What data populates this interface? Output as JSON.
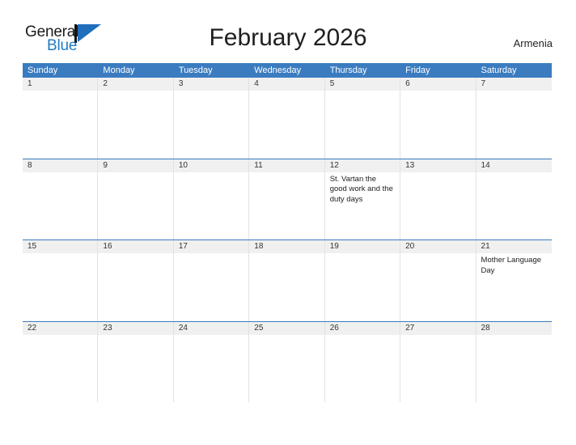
{
  "brand": {
    "name_part1": "General",
    "name_part2": "Blue",
    "logo_icon": "triangle-flag-icon",
    "accent_color": "#1f6fbb"
  },
  "header": {
    "title": "February 2026",
    "country": "Armenia"
  },
  "colors": {
    "header_blue": "#3b7cc0",
    "number_band": "#f0f0f0",
    "grid_line": "#e2e2e2",
    "text": "#222222"
  },
  "calendar": {
    "weekday_headers": [
      "Sunday",
      "Monday",
      "Tuesday",
      "Wednesday",
      "Thursday",
      "Friday",
      "Saturday"
    ],
    "weeks": [
      [
        {
          "day": "1",
          "events": []
        },
        {
          "day": "2",
          "events": []
        },
        {
          "day": "3",
          "events": []
        },
        {
          "day": "4",
          "events": []
        },
        {
          "day": "5",
          "events": []
        },
        {
          "day": "6",
          "events": []
        },
        {
          "day": "7",
          "events": []
        }
      ],
      [
        {
          "day": "8",
          "events": []
        },
        {
          "day": "9",
          "events": []
        },
        {
          "day": "10",
          "events": []
        },
        {
          "day": "11",
          "events": []
        },
        {
          "day": "12",
          "events": [
            "St. Vartan the good work and the duty days"
          ]
        },
        {
          "day": "13",
          "events": []
        },
        {
          "day": "14",
          "events": []
        }
      ],
      [
        {
          "day": "15",
          "events": []
        },
        {
          "day": "16",
          "events": []
        },
        {
          "day": "17",
          "events": []
        },
        {
          "day": "18",
          "events": []
        },
        {
          "day": "19",
          "events": []
        },
        {
          "day": "20",
          "events": []
        },
        {
          "day": "21",
          "events": [
            "Mother Language Day"
          ]
        }
      ],
      [
        {
          "day": "22",
          "events": []
        },
        {
          "day": "23",
          "events": []
        },
        {
          "day": "24",
          "events": []
        },
        {
          "day": "25",
          "events": []
        },
        {
          "day": "26",
          "events": []
        },
        {
          "day": "27",
          "events": []
        },
        {
          "day": "28",
          "events": []
        },
        {
          "day": "",
          "events": []
        }
      ]
    ]
  }
}
